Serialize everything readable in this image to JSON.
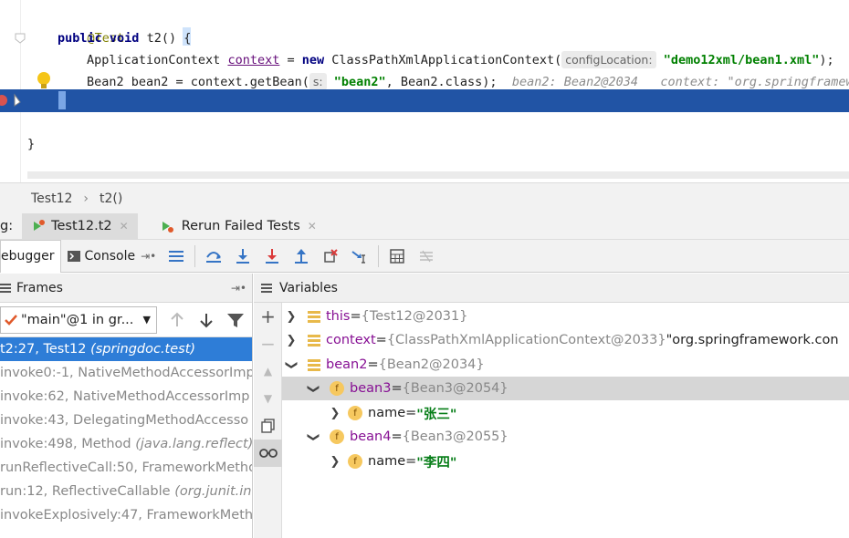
{
  "editor": {
    "line1": {
      "annotation": "@Test"
    },
    "line2": {
      "kw_public": "public",
      "kw_void": "void",
      "signature": "t2()",
      "brace": "{"
    },
    "line3": {
      "type": "ApplicationContext",
      "var": "context",
      "eq": " = ",
      "kw_new": "new",
      "ctor": " ClassPathXmlApplicationContext(",
      "hint": "configLocation:",
      "arg": "\"demo12xml/bean1.xml\"",
      "end": ");"
    },
    "line4": {
      "code": "Bean2 bean2 = context.getBean(",
      "hint": "s:",
      "arg": "\"bean2\"",
      "rest": ", Bean2.class);",
      "inline": "bean2: Bean2@2034   context: \"org.springframework"
    },
    "line5": {
      "brace": "}"
    },
    "line7": {
      "brace": "}"
    }
  },
  "breadcrumb": {
    "class": "Test12",
    "method": "t2()"
  },
  "run_tabs": {
    "prefix": "g:",
    "tabs": [
      {
        "label": "Test12.t2"
      },
      {
        "label": "Rerun Failed Tests"
      }
    ]
  },
  "debug_toolbar": {
    "debugger_label": "ebugger",
    "console_label": "Console"
  },
  "frames": {
    "title": "Frames",
    "thread": "\"main\"@1 in gr...",
    "items": [
      {
        "method": "t2:27, Test12 ",
        "pkg": "(springdoc.test)"
      },
      {
        "method": "invoke0:-1, NativeMethodAccessorImp",
        "pkg": ""
      },
      {
        "method": "invoke:62, NativeMethodAccessorImp",
        "pkg": ""
      },
      {
        "method": "invoke:43, DelegatingMethodAccesso",
        "pkg": ""
      },
      {
        "method": "invoke:498, Method ",
        "pkg": "(java.lang.reflect)"
      },
      {
        "method": "runReflectiveCall:50, FrameworkMetho",
        "pkg": ""
      },
      {
        "method": "run:12, ReflectiveCallable ",
        "pkg": "(org.junit.int"
      },
      {
        "method": "invokeExplosively:47, FrameworkMeth",
        "pkg": ""
      }
    ]
  },
  "variables": {
    "title": "Variables",
    "rows": [
      {
        "name": "this",
        "eq": " = ",
        "obj": "{Test12@2031}",
        "extra": ""
      },
      {
        "name": "context",
        "eq": " = ",
        "obj": "{ClassPathXmlApplicationContext@2033}",
        "extra": " \"org.springframework.con"
      },
      {
        "name": "bean2",
        "eq": " = ",
        "obj": "{Bean2@2034}",
        "extra": ""
      },
      {
        "name": "bean3",
        "eq": " = ",
        "obj": "{Bean3@2054}",
        "extra": ""
      },
      {
        "name": "name",
        "eq": " = ",
        "obj": "",
        "extra": "\"张三\""
      },
      {
        "name": "bean4",
        "eq": " = ",
        "obj": "{Bean3@2055}",
        "extra": ""
      },
      {
        "name": "name",
        "eq": " = ",
        "obj": "",
        "extra": "\"李四\""
      }
    ]
  },
  "colors": {
    "execution_line": "#2154a5",
    "selected_frame": "#2e7dd7",
    "field_icon": "#f6c85f",
    "string_value": "#067d17"
  }
}
